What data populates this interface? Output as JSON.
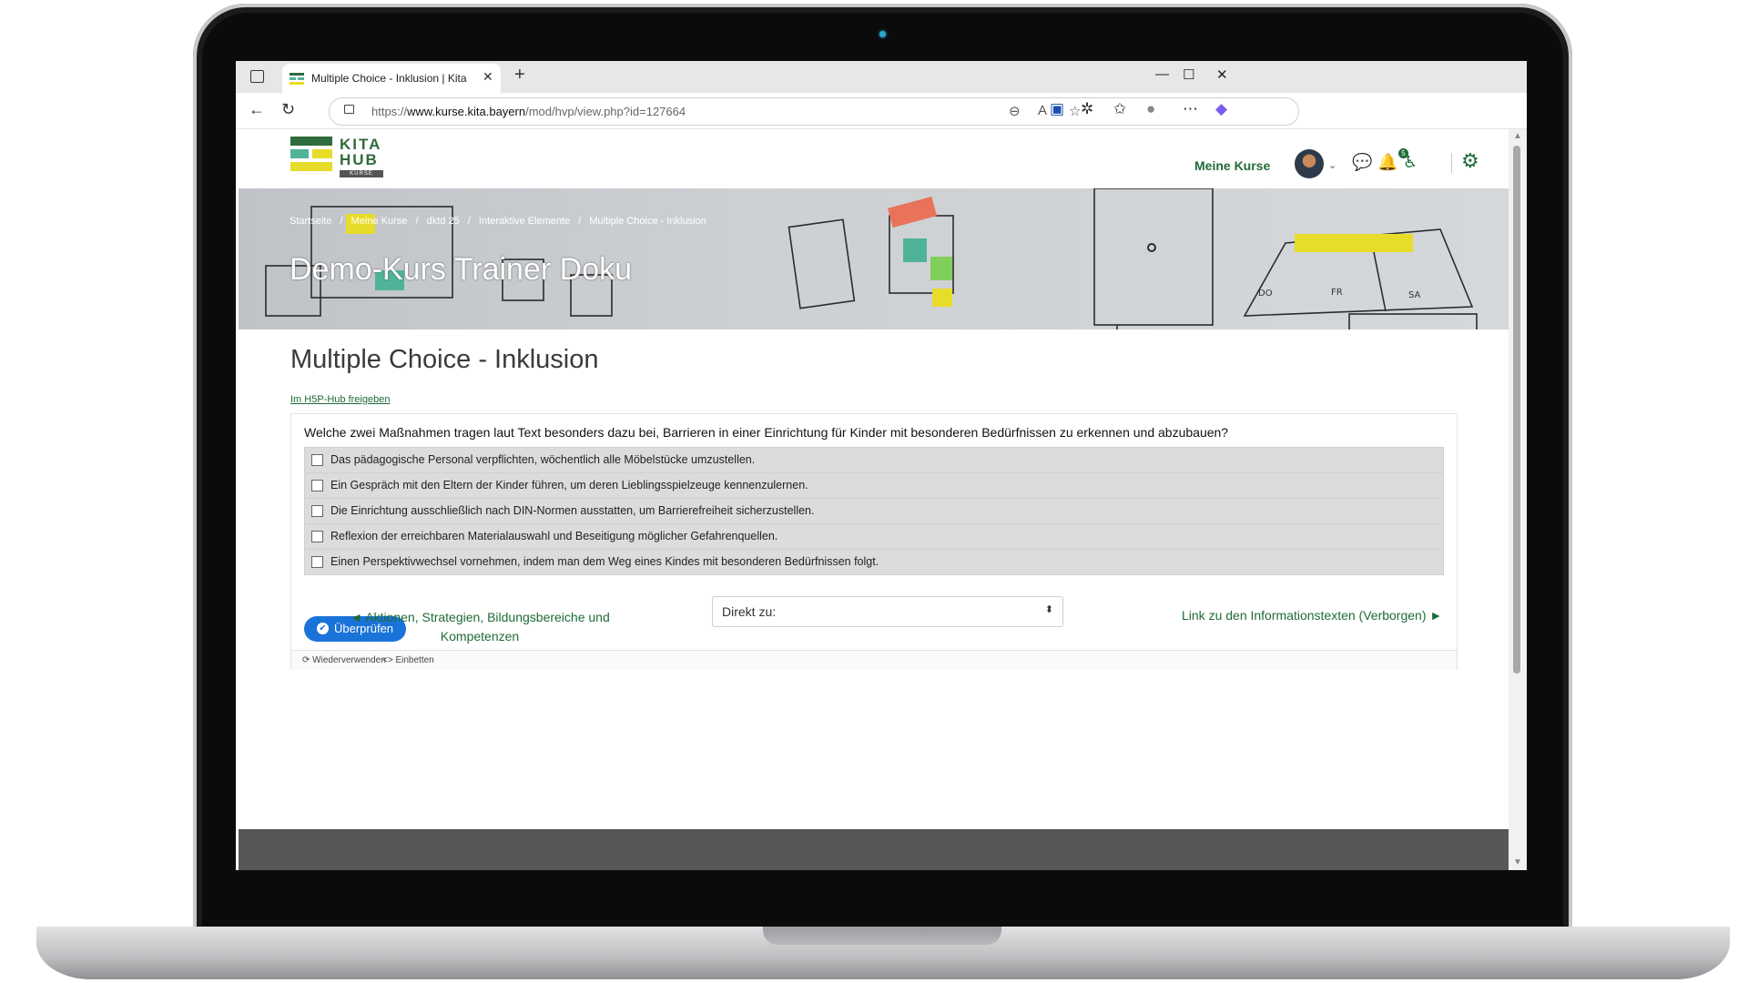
{
  "browser": {
    "tab_title": "Multiple Choice - Inklusion | Kita",
    "tab_close": "✕",
    "new_tab": "+",
    "url_prefix": "https://",
    "url_domain": "www.kurse.kita.bayern",
    "url_path": "/mod/hvp/view.php?id=127664",
    "window_controls": [
      "—",
      "☐",
      "✕"
    ]
  },
  "site": {
    "logo_line1": "KITA",
    "logo_line2": "HUB",
    "logo_sub": "KURSE",
    "nav_my_courses": "Meine Kurse",
    "notification_count": "5"
  },
  "banner": {
    "breadcrumb": [
      "Startseite",
      "/",
      "Meine Kurse",
      "/",
      "dktd 25",
      "/",
      "Interaktive Elemente",
      "/",
      "Multiple Choice - Inklusion"
    ],
    "course_title": "Demo-Kurs Trainer Doku"
  },
  "activity": {
    "title": "Multiple Choice - Inklusion",
    "hub_link": "Im H5P-Hub freigeben",
    "question": "Welche zwei Maßnahmen tragen laut Text besonders dazu bei, Barrieren in einer Einrichtung für Kinder mit besonderen Bedürfnissen zu erkennen und abzubauen?",
    "options": [
      "Das pädagogische Personal verpflichten, wöchentlich alle Möbelstücke umzustellen.",
      "Ein Gespräch mit den Eltern der Kinder führen, um deren Lieblingsspielzeuge kennenzulernen.",
      "Die Einrichtung ausschließlich nach DIN-Normen ausstatten, um Barrierefreiheit sicherzustellen.",
      "Reflexion der erreichbaren Materialauswahl und Beseitigung möglicher Gefahrenquellen.",
      "Einen Perspektivwechsel vornehmen, indem man dem Weg eines Kindes mit besonderen Bedürfnissen folgt."
    ],
    "check_label": "Überprüfen",
    "reuse_label": "Wiederverwenden",
    "embed_label": "Einbetten"
  },
  "navigation": {
    "prev_label": "◄ Aktionen, Strategien, Bildungsbereiche und Kompetenzen",
    "jump_label": "Direkt zu:",
    "next_label": "Link zu den Informationstexten (Verborgen) ►"
  },
  "colors": {
    "brand_green": "#1f6b36",
    "button_blue": "#1a73d9",
    "logo_yellow": "#e8dc2a",
    "logo_teal": "#4fb39a"
  }
}
